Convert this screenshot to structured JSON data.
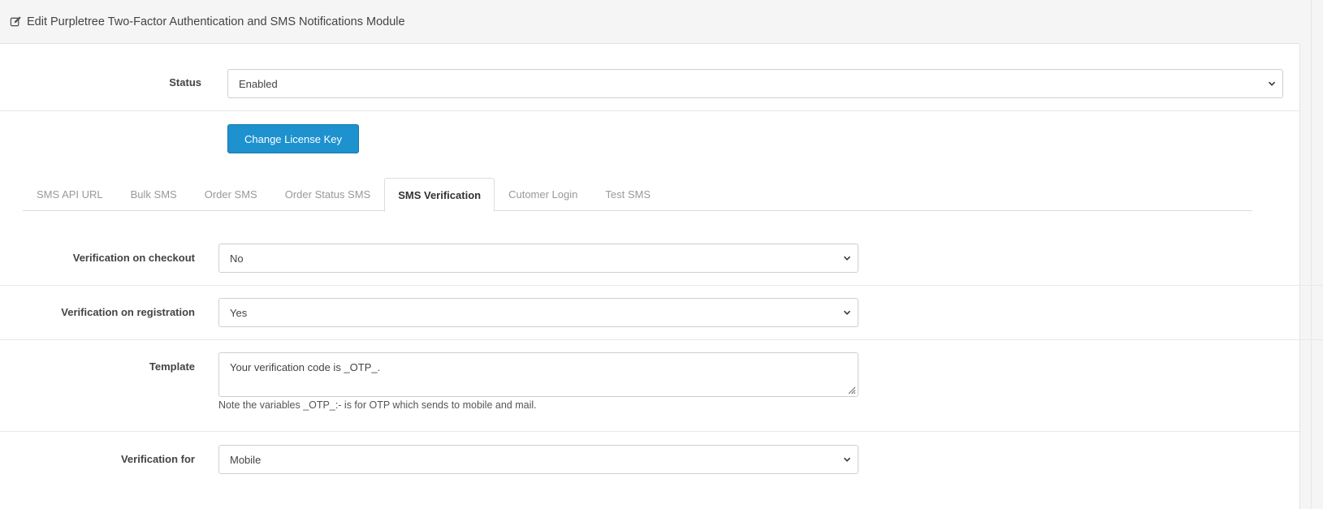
{
  "header": {
    "title": "Edit Purpletree Two-Factor Authentication and SMS Notifications Module",
    "icon": "pencil-square-icon"
  },
  "status": {
    "label": "Status",
    "value": "Enabled"
  },
  "license": {
    "button_label": "Change License Key"
  },
  "tabs": [
    {
      "label": "SMS API URL",
      "active": false
    },
    {
      "label": "Bulk SMS",
      "active": false
    },
    {
      "label": "Order SMS",
      "active": false
    },
    {
      "label": "Order Status SMS",
      "active": false
    },
    {
      "label": "SMS Verification",
      "active": true
    },
    {
      "label": "Cutomer Login",
      "active": false
    },
    {
      "label": "Test SMS",
      "active": false
    }
  ],
  "form": {
    "checkout": {
      "label": "Verification on checkout",
      "value": "No"
    },
    "registration": {
      "label": "Verification on registration",
      "value": "Yes"
    },
    "template": {
      "label": "Template",
      "value": "Your verification code is _OTP_.",
      "help": "Note the variables _OTP_:- is for OTP which sends to mobile and mail."
    },
    "verification_for": {
      "label": "Verification for",
      "value": "Mobile"
    }
  },
  "colors": {
    "primary": "#1e91cf",
    "border": "#cfcfcf",
    "heading_bg": "#f5f5f5"
  }
}
